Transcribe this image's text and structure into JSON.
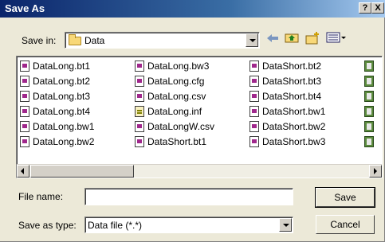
{
  "window": {
    "title": "Save As",
    "help_label": "?",
    "close_label": "X"
  },
  "save_in": {
    "label": "Save in:",
    "value": "Data"
  },
  "toolbar": {
    "back_icon": "back-arrow-icon",
    "up_icon": "up-folder-icon",
    "new_folder_icon": "new-folder-icon",
    "view_menu_icon": "view-menu-icon"
  },
  "files": [
    {
      "name": "DataLong.bt1",
      "icon": "data"
    },
    {
      "name": "DataLong.bt2",
      "icon": "data"
    },
    {
      "name": "DataLong.bt3",
      "icon": "data"
    },
    {
      "name": "DataLong.bt4",
      "icon": "data"
    },
    {
      "name": "DataLong.bw1",
      "icon": "data"
    },
    {
      "name": "DataLong.bw2",
      "icon": "data"
    },
    {
      "name": "DataLong.bw3",
      "icon": "data"
    },
    {
      "name": "DataLong.cfg",
      "icon": "data"
    },
    {
      "name": "DataLong.csv",
      "icon": "data"
    },
    {
      "name": "DataLong.inf",
      "icon": "cfg"
    },
    {
      "name": "DataLongW.csv",
      "icon": "data"
    },
    {
      "name": "DataShort.bt1",
      "icon": "data"
    },
    {
      "name": "DataShort.bt2",
      "icon": "data"
    },
    {
      "name": "DataShort.bt3",
      "icon": "data"
    },
    {
      "name": "DataShort.bt4",
      "icon": "data"
    },
    {
      "name": "DataShort.bw1",
      "icon": "data"
    },
    {
      "name": "DataShort.bw2",
      "icon": "data"
    },
    {
      "name": "DataShort.bw3",
      "icon": "data"
    }
  ],
  "file_name": {
    "label": "File name:",
    "value": ""
  },
  "save_as_type": {
    "label": "Save as type:",
    "value": "Data file (*.*)"
  },
  "buttons": {
    "save": "Save",
    "cancel": "Cancel"
  }
}
